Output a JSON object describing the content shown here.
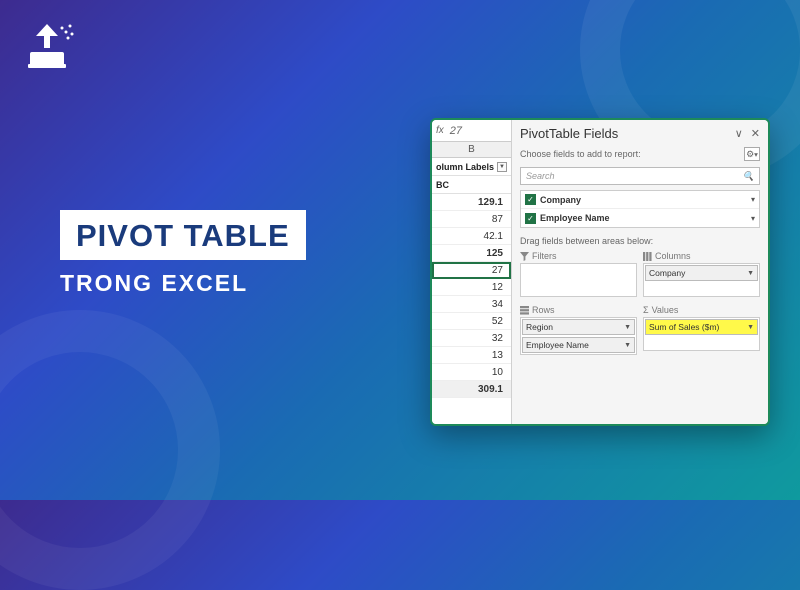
{
  "title": {
    "main": "PIVOT TABLE",
    "sub": "TRONG EXCEL"
  },
  "formula_bar": {
    "fx": "fx",
    "value": "27"
  },
  "column_header": "B",
  "pivot_left": {
    "label1": "olumn Labels",
    "label2": "BC",
    "values": [
      "129.1",
      "87",
      "42.1",
      "125",
      "27",
      "12",
      "34",
      "52",
      "32",
      "13",
      "10",
      "309.1"
    ]
  },
  "fields_pane": {
    "title": "PivotTable Fields",
    "choose_label": "Choose fields to add to report:",
    "search_placeholder": "Search",
    "fields": [
      {
        "name": "Company",
        "checked": true
      },
      {
        "name": "Employee Name",
        "checked": true
      }
    ],
    "drag_label": "Drag fields between areas below:",
    "areas": {
      "filters": {
        "label": "Filters",
        "items": []
      },
      "columns": {
        "label": "Columns",
        "items": [
          "Company"
        ]
      },
      "rows": {
        "label": "Rows",
        "items": [
          "Region",
          "Employee Name"
        ]
      },
      "values": {
        "label": "Values",
        "items": [
          "Sum of Sales ($m)"
        ]
      }
    }
  },
  "chart_data": {
    "type": "table",
    "title": "PivotTable partial view",
    "column_labels_field": "Company",
    "visible_column": "BC",
    "row_values": [
      129.1,
      87,
      42.1,
      125,
      27,
      12,
      34,
      52,
      32,
      13,
      10
    ],
    "grand_total": 309.1,
    "selected_cell_value": 27,
    "fields": {
      "rows": [
        "Region",
        "Employee Name"
      ],
      "columns": [
        "Company"
      ],
      "values": [
        "Sum of Sales ($m)"
      ],
      "filters": []
    }
  }
}
